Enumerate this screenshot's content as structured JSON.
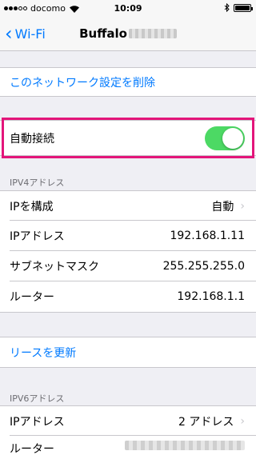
{
  "status_bar": {
    "carrier": "docomo",
    "time": "10:09"
  },
  "nav": {
    "back_label": "Wi-Fi",
    "title": "Buffalo"
  },
  "forget_network": "このネットワーク設定を削除",
  "auto_join": {
    "label": "自動接続",
    "enabled": true
  },
  "ipv4": {
    "header": "IPV4アドレス",
    "configure_ip_label": "IPを構成",
    "configure_ip_value": "自動",
    "ip_address_label": "IPアドレス",
    "ip_address_value": "192.168.1.11",
    "subnet_label": "サブネットマスク",
    "subnet_value": "255.255.255.0",
    "router_label": "ルーター",
    "router_value": "192.168.1.1"
  },
  "renew_lease": "リースを更新",
  "ipv6": {
    "header": "IPV6アドレス",
    "ip_address_label": "IPアドレス",
    "ip_address_value": "2 アドレス",
    "router_label": "ルーター"
  },
  "colors": {
    "accent": "#007aff",
    "toggle_on": "#4cd964",
    "highlight": "#e3157a"
  }
}
